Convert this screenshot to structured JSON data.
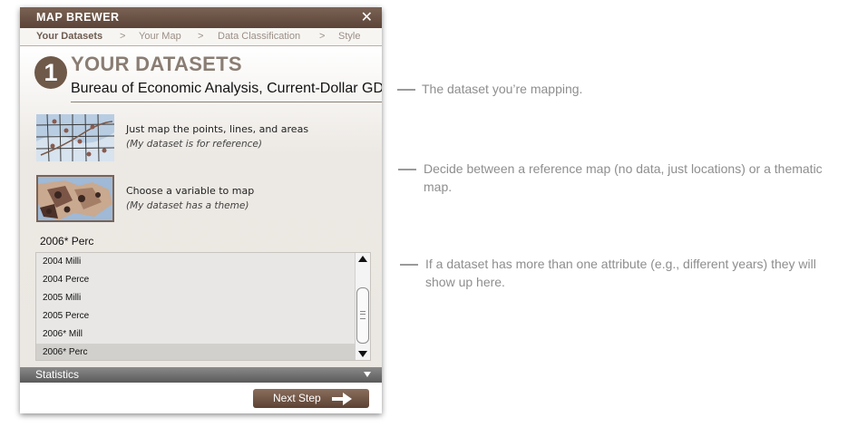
{
  "panel": {
    "title": "MAP BREWER",
    "close_glyph": "✕"
  },
  "breadcrumb": {
    "items": [
      "Your Datasets",
      "Your Map",
      "Data Classification",
      "Style"
    ],
    "separator": ">"
  },
  "step": {
    "number": "1",
    "title": "YOUR DATASETS",
    "dataset_name": "Bureau of Economic Analysis, Current-Dollar GDP"
  },
  "options": [
    {
      "label": "Just map the points, lines, and areas",
      "sublabel": "(My dataset is for reference)",
      "icon": "reference-map-thumbnail"
    },
    {
      "label": "Choose a variable to map",
      "sublabel": "(My dataset has a theme)",
      "icon": "thematic-map-thumbnail"
    }
  ],
  "attribute": {
    "current": "2006* Perc",
    "list": [
      "2004 Milli",
      "2004 Perce",
      "2005 Milli",
      "2005 Perce",
      "2006* Mill",
      "2006* Perc"
    ],
    "selected_index": 5
  },
  "statistics": {
    "label": "Statistics"
  },
  "footer": {
    "next_label": "Next Step"
  },
  "annotations": [
    "The dataset you’re mapping.",
    "Decide between a reference map (no data, just locations) or a thematic map.",
    "If a dataset has more than one attribute (e.g., different years) they will show up here."
  ],
  "colors": {
    "brand_brown": "#5b4437",
    "step_circle": "#6f5949",
    "annotation_gray": "#8e8e8e",
    "map_water": "#9fb9d6",
    "map_land": "#c9a98f"
  }
}
